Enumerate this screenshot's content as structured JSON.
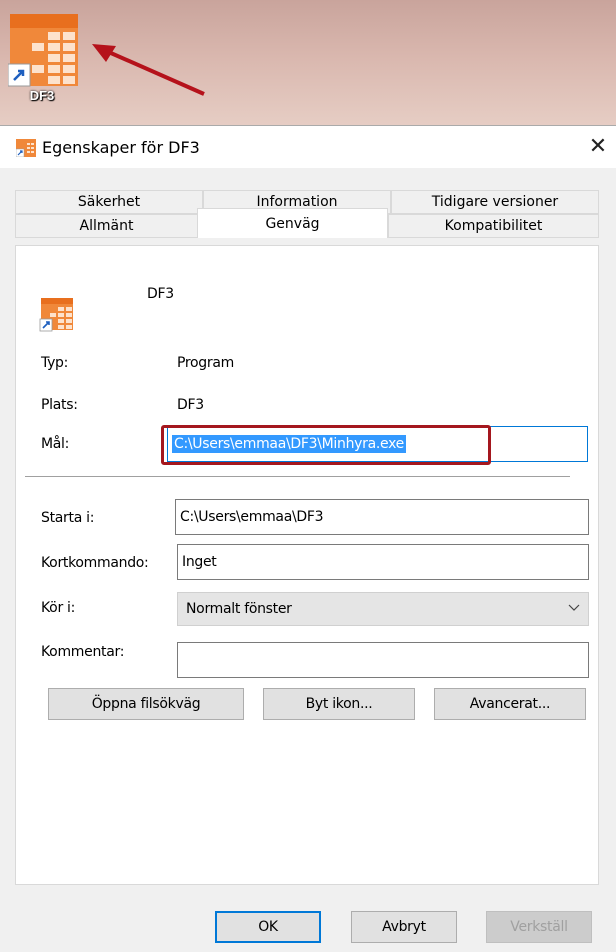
{
  "desktop": {
    "shortcut_label": "DF3"
  },
  "dialog": {
    "title": "Egenskaper för DF3",
    "close_glyph": "✕",
    "tabs_back": [
      "Säkerhet",
      "Information",
      "Tidigare versioner"
    ],
    "tabs_front": [
      "Allmänt",
      "Genväg",
      "Kompatibilitet"
    ],
    "active_tab": "Genväg",
    "shortcut_name": "DF3",
    "fields": {
      "typ_label": "Typ:",
      "typ_value": "Program",
      "plats_label": "Plats:",
      "plats_value": "DF3",
      "mal_label": "Mål:",
      "mal_value": "C:\\Users\\emmaa\\DF3\\Minhyra.exe",
      "starta_label": "Starta i:",
      "starta_value": "C:\\Users\\emmaa\\DF3",
      "kort_label": "Kortkommando:",
      "kort_value": "Inget",
      "kor_label": "Kör i:",
      "kor_value": "Normalt fönster",
      "kommentar_label": "Kommentar:",
      "kommentar_value": ""
    },
    "buttons": {
      "open_location": "Öppna filsökväg",
      "change_icon": "Byt ikon...",
      "advanced": "Avancerat...",
      "ok": "OK",
      "cancel": "Avbryt",
      "apply": "Verkställ"
    }
  },
  "colors": {
    "icon_orange": "#f0883a",
    "selection": "#3399ff",
    "highlight_box": "#a4171e",
    "focus_blue": "#0078d7"
  }
}
